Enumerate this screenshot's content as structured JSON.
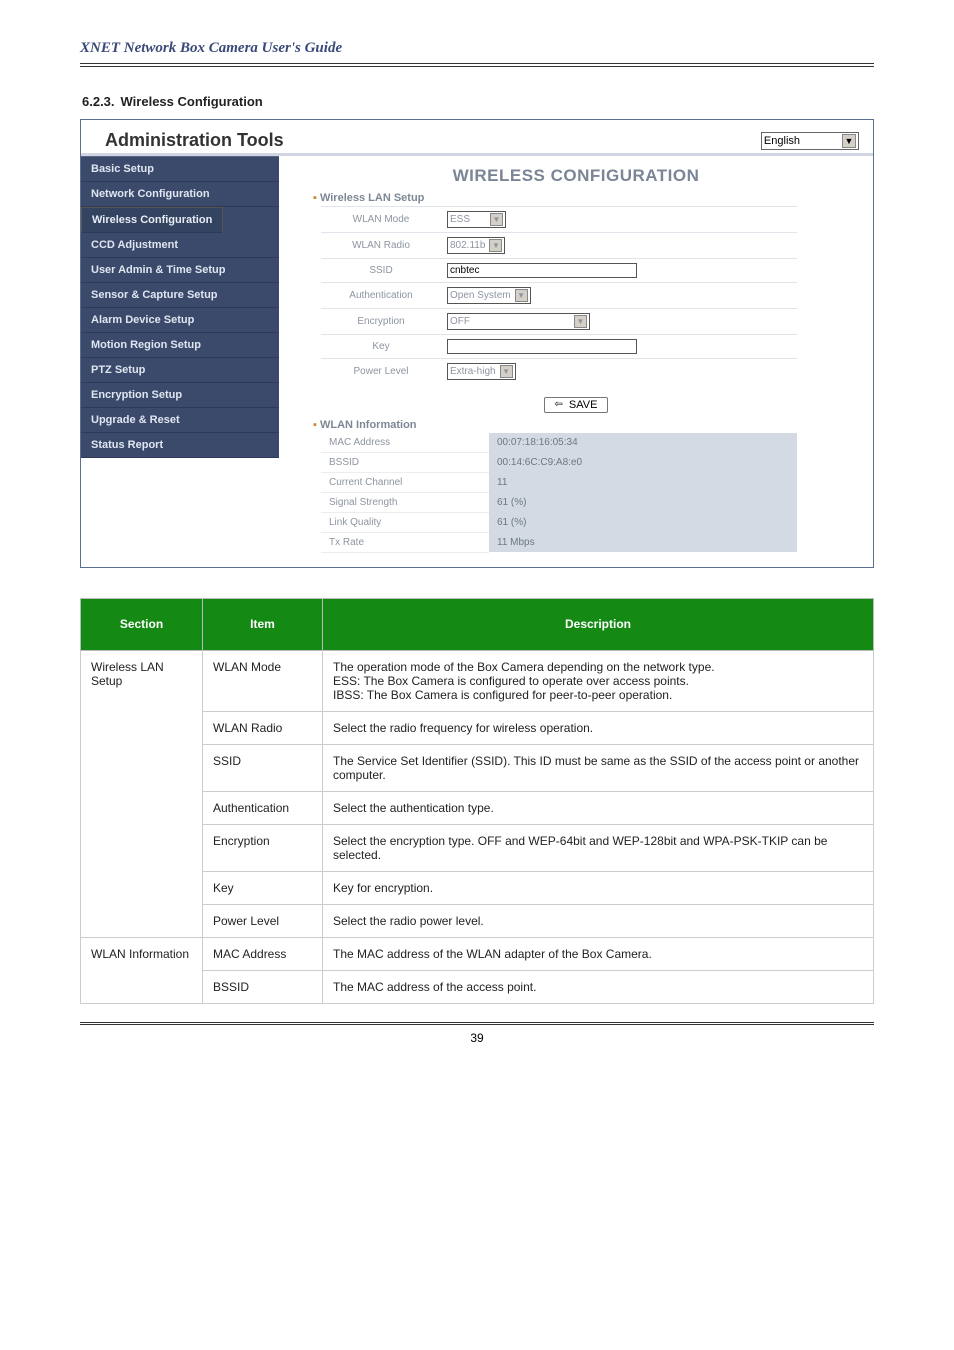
{
  "doc_title": "XNET Network Box Camera User's Guide",
  "section_number": "6.2.3.",
  "section_title": "Wireless Configuration",
  "admin_tools": {
    "title": "Administration Tools",
    "lang": "English",
    "nav": [
      "Basic Setup",
      "Network Configuration",
      "Wireless Configuration",
      "CCD Adjustment",
      "User Admin & Time Setup",
      "Sensor & Capture Setup",
      "Alarm Device Setup",
      "Motion Region Setup",
      "PTZ Setup",
      "Encryption Setup",
      "Upgrade & Reset",
      "Status Report"
    ],
    "main_title": "WIRELESS CONFIGURATION",
    "group1": "Wireless LAN Setup",
    "fields": {
      "wlan_mode_l": "WLAN Mode",
      "wlan_mode_v": "ESS",
      "wlan_radio_l": "WLAN Radio",
      "wlan_radio_v": "802.11b",
      "ssid_l": "SSID",
      "ssid_v": "cnbtec",
      "auth_l": "Authentication",
      "auth_v": "Open System",
      "enc_l": "Encryption",
      "enc_v": "OFF",
      "key_l": "Key",
      "key_v": "",
      "pwr_l": "Power Level",
      "pwr_v": "Extra-high"
    },
    "save_label": "SAVE",
    "group2": "WLAN Information",
    "info": {
      "mac_l": "MAC Address",
      "mac_v": "00:07:18:16:05:34",
      "bssid_l": "BSSID",
      "bssid_v": "00:14:6C:C9:A8:e0",
      "ch_l": "Current Channel",
      "ch_v": "11",
      "sig_l": "Signal Strength",
      "sig_v": "61 (%)",
      "lq_l": "Link Quality",
      "lq_v": "61 (%)",
      "tx_l": "Tx Rate",
      "tx_v": "11 Mbps"
    }
  },
  "desc_table": {
    "h1": "Section",
    "h2": "Item",
    "h3": "Description",
    "rows": [
      {
        "sec": "Wireless LAN Setup",
        "sec_rowspan": 7,
        "item": "WLAN Mode",
        "desc": "The operation mode of the Box Camera depending on the network type.\nESS: The Box Camera is configured to operate over access points.\nIBSS: The Box Camera is configured for peer-to-peer operation."
      },
      {
        "item": "WLAN Radio",
        "desc": "Select the radio frequency for wireless operation."
      },
      {
        "item": "SSID",
        "desc": "The Service Set Identifier (SSID). This ID must be same as the SSID of the access point or another computer."
      },
      {
        "item": "Authentication",
        "desc": "Select the authentication type."
      },
      {
        "item": "Encryption",
        "desc": "Select the encryption type. OFF and WEP-64bit and WEP-128bit and WPA-PSK-TKIP can be selected."
      },
      {
        "item": "Key",
        "desc": "Key for encryption."
      },
      {
        "item": "Power Level",
        "desc": "Select the radio power level."
      }
    ],
    "rows2": [
      {
        "sec": "WLAN Information",
        "sec_rowspan": 2,
        "item": "MAC Address",
        "desc": "The MAC address of the WLAN adapter of the Box Camera."
      },
      {
        "item": "BSSID",
        "desc": "The MAC address of the access point."
      }
    ]
  },
  "page_number": "39"
}
